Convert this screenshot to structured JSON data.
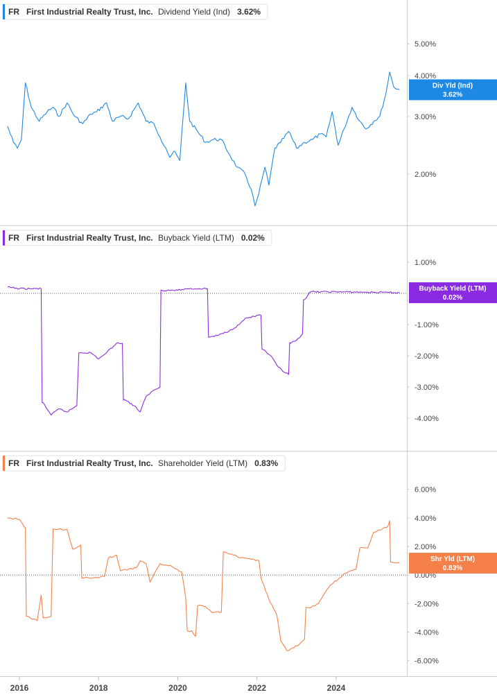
{
  "charts": [
    {
      "ticker": "FR",
      "company": "First Industrial Realty Trust, Inc.",
      "metric": "Dividend Yield (Ind)",
      "value": "3.62%",
      "flag_label": "Div Yld (Ind)",
      "flag_value": "3.62%",
      "color": "#1e88e5"
    },
    {
      "ticker": "FR",
      "company": "First Industrial Realty Trust, Inc.",
      "metric": "Buyback Yield (LTM)",
      "value": "0.02%",
      "flag_label": "Buyback Yield (LTM)",
      "flag_value": "0.02%",
      "color": "#8a2be2"
    },
    {
      "ticker": "FR",
      "company": "First Industrial Realty Trust, Inc.",
      "metric": "Shareholder Yield (LTM)",
      "value": "0.83%",
      "flag_label": "Shr Yld (LTM)",
      "flag_value": "0.83%",
      "color": "#f5804a"
    }
  ],
  "x_ticks": [
    "2016",
    "2018",
    "2020",
    "2022",
    "2024"
  ],
  "chart_data": [
    {
      "type": "line",
      "title": "Dividend Yield (Ind)",
      "scale": "log",
      "y_ticks": [
        "5.00%",
        "4.00%",
        "3.00%",
        "2.00%"
      ],
      "ylim": [
        1.5,
        5.6
      ],
      "series": [
        {
          "name": "Dividend Yield (Ind)",
          "points": [
            [
              2015.7,
              2.8
            ],
            [
              2015.85,
              2.5
            ],
            [
              2015.95,
              2.4
            ],
            [
              2016.05,
              2.55
            ],
            [
              2016.15,
              3.8
            ],
            [
              2016.3,
              3.2
            ],
            [
              2016.5,
              2.9
            ],
            [
              2016.7,
              3.1
            ],
            [
              2016.85,
              3.2
            ],
            [
              2017.0,
              3.0
            ],
            [
              2017.2,
              3.3
            ],
            [
              2017.4,
              3.0
            ],
            [
              2017.6,
              2.85
            ],
            [
              2017.8,
              3.05
            ],
            [
              2017.95,
              3.1
            ],
            [
              2018.2,
              3.3
            ],
            [
              2018.35,
              2.9
            ],
            [
              2018.55,
              3.0
            ],
            [
              2018.75,
              2.95
            ],
            [
              2019.0,
              3.3
            ],
            [
              2019.2,
              2.9
            ],
            [
              2019.4,
              2.85
            ],
            [
              2019.55,
              2.6
            ],
            [
              2019.7,
              2.4
            ],
            [
              2019.8,
              2.25
            ],
            [
              2019.9,
              2.35
            ],
            [
              2020.05,
              2.2
            ],
            [
              2020.2,
              3.8
            ],
            [
              2020.3,
              2.9
            ],
            [
              2020.5,
              2.7
            ],
            [
              2020.7,
              2.5
            ],
            [
              2020.9,
              2.55
            ],
            [
              2021.1,
              2.55
            ],
            [
              2021.3,
              2.3
            ],
            [
              2021.5,
              2.1
            ],
            [
              2021.7,
              2.0
            ],
            [
              2021.85,
              1.8
            ],
            [
              2021.95,
              1.6
            ],
            [
              2022.05,
              1.75
            ],
            [
              2022.2,
              2.1
            ],
            [
              2022.3,
              1.85
            ],
            [
              2022.45,
              2.4
            ],
            [
              2022.6,
              2.5
            ],
            [
              2022.8,
              2.7
            ],
            [
              2023.0,
              2.4
            ],
            [
              2023.2,
              2.5
            ],
            [
              2023.4,
              2.55
            ],
            [
              2023.6,
              2.65
            ],
            [
              2023.75,
              2.6
            ],
            [
              2023.9,
              3.1
            ],
            [
              2024.05,
              2.45
            ],
            [
              2024.2,
              2.75
            ],
            [
              2024.4,
              3.2
            ],
            [
              2024.6,
              2.9
            ],
            [
              2024.75,
              2.75
            ],
            [
              2024.95,
              2.9
            ],
            [
              2025.1,
              3.0
            ],
            [
              2025.25,
              3.5
            ],
            [
              2025.35,
              4.1
            ],
            [
              2025.45,
              3.7
            ],
            [
              2025.6,
              3.62
            ]
          ]
        }
      ]
    },
    {
      "type": "line",
      "title": "Buyback Yield (LTM)",
      "y_ticks": [
        "1.00%",
        "-1.00%",
        "-2.00%",
        "-3.00%",
        "-4.00%"
      ],
      "ylim": [
        -4.6,
        1.4
      ],
      "reference_line": 0,
      "series": [
        {
          "name": "Buyback Yield (LTM)",
          "points": [
            [
              2015.7,
              0.2
            ],
            [
              2016.0,
              0.15
            ],
            [
              2016.3,
              0.15
            ],
            [
              2016.55,
              0.15
            ],
            [
              2016.6,
              -3.5
            ],
            [
              2016.8,
              -3.9
            ],
            [
              2017.0,
              -3.7
            ],
            [
              2017.2,
              -3.8
            ],
            [
              2017.45,
              -3.6
            ],
            [
              2017.55,
              -1.9
            ],
            [
              2017.8,
              -1.9
            ],
            [
              2018.0,
              -2.1
            ],
            [
              2018.2,
              -1.9
            ],
            [
              2018.45,
              -1.6
            ],
            [
              2018.6,
              -1.6
            ],
            [
              2018.65,
              -3.4
            ],
            [
              2018.9,
              -3.6
            ],
            [
              2019.05,
              -3.8
            ],
            [
              2019.2,
              -3.3
            ],
            [
              2019.4,
              -3.1
            ],
            [
              2019.55,
              -3.0
            ],
            [
              2019.6,
              0.1
            ],
            [
              2020.0,
              0.1
            ],
            [
              2020.25,
              0.15
            ],
            [
              2020.75,
              0.15
            ],
            [
              2020.8,
              -1.4
            ],
            [
              2021.0,
              -1.35
            ],
            [
              2021.3,
              -1.2
            ],
            [
              2021.55,
              -1.0
            ],
            [
              2021.7,
              -0.8
            ],
            [
              2022.1,
              -0.7
            ],
            [
              2022.15,
              -1.8
            ],
            [
              2022.35,
              -2.0
            ],
            [
              2022.5,
              -2.3
            ],
            [
              2022.65,
              -2.5
            ],
            [
              2022.8,
              -2.6
            ],
            [
              2022.85,
              -1.6
            ],
            [
              2023.0,
              -1.5
            ],
            [
              2023.15,
              -1.3
            ],
            [
              2023.2,
              -0.2
            ],
            [
              2023.35,
              0.05
            ],
            [
              2024.0,
              0.05
            ],
            [
              2024.6,
              0.04
            ],
            [
              2025.3,
              0.03
            ],
            [
              2025.6,
              0.02
            ]
          ]
        }
      ]
    },
    {
      "type": "line",
      "title": "Shareholder Yield (LTM)",
      "y_ticks": [
        "6.00%",
        "4.00%",
        "2.00%",
        "0.00%",
        "-2.00%",
        "-4.00%",
        "-6.00%"
      ],
      "ylim": [
        -6.6,
        7.0
      ],
      "reference_line": 0,
      "series": [
        {
          "name": "Shareholder Yield (LTM)",
          "points": [
            [
              2015.7,
              4.0
            ],
            [
              2016.0,
              3.9
            ],
            [
              2016.15,
              3.3
            ],
            [
              2016.2,
              -2.9
            ],
            [
              2016.45,
              -3.2
            ],
            [
              2016.55,
              -1.4
            ],
            [
              2016.6,
              -3.0
            ],
            [
              2016.8,
              -2.9
            ],
            [
              2016.9,
              3.2
            ],
            [
              2017.2,
              3.2
            ],
            [
              2017.35,
              1.8
            ],
            [
              2017.55,
              2.1
            ],
            [
              2017.6,
              -0.2
            ],
            [
              2017.9,
              -0.2
            ],
            [
              2018.15,
              -0.1
            ],
            [
              2018.25,
              1.2
            ],
            [
              2018.45,
              1.4
            ],
            [
              2018.55,
              0.3
            ],
            [
              2018.75,
              0.4
            ],
            [
              2018.95,
              0.5
            ],
            [
              2019.05,
              1.0
            ],
            [
              2019.2,
              0.8
            ],
            [
              2019.3,
              -0.5
            ],
            [
              2019.55,
              0.8
            ],
            [
              2019.7,
              0.7
            ],
            [
              2019.85,
              0.6
            ],
            [
              2020.1,
              0.2
            ],
            [
              2020.2,
              -1.6
            ],
            [
              2020.35,
              -3.9
            ],
            [
              2020.45,
              -4.3
            ],
            [
              2020.55,
              -2.1
            ],
            [
              2020.7,
              -2.2
            ],
            [
              2020.85,
              -2.6
            ],
            [
              2021.1,
              -2.6
            ],
            [
              2021.2,
              1.6
            ],
            [
              2021.4,
              1.4
            ],
            [
              2021.6,
              1.2
            ],
            [
              2021.85,
              1.1
            ],
            [
              2022.05,
              1.0
            ],
            [
              2022.1,
              -0.2
            ],
            [
              2022.3,
              -1.7
            ],
            [
              2022.5,
              -2.8
            ],
            [
              2022.6,
              -4.6
            ],
            [
              2022.75,
              -5.3
            ],
            [
              2022.9,
              -5.1
            ],
            [
              2023.05,
              -4.9
            ],
            [
              2023.2,
              -4.5
            ],
            [
              2023.35,
              -2.3
            ],
            [
              2023.55,
              -2.0
            ],
            [
              2023.7,
              -1.3
            ],
            [
              2023.85,
              -0.7
            ],
            [
              2024.05,
              -0.3
            ],
            [
              2024.2,
              0.1
            ],
            [
              2024.5,
              0.4
            ],
            [
              2024.6,
              1.9
            ],
            [
              2024.8,
              1.9
            ],
            [
              2024.95,
              3.0
            ],
            [
              2025.15,
              3.2
            ],
            [
              2025.3,
              3.4
            ],
            [
              2025.35,
              3.8
            ],
            [
              2025.4,
              0.9
            ],
            [
              2025.6,
              0.83
            ]
          ]
        }
      ]
    }
  ]
}
